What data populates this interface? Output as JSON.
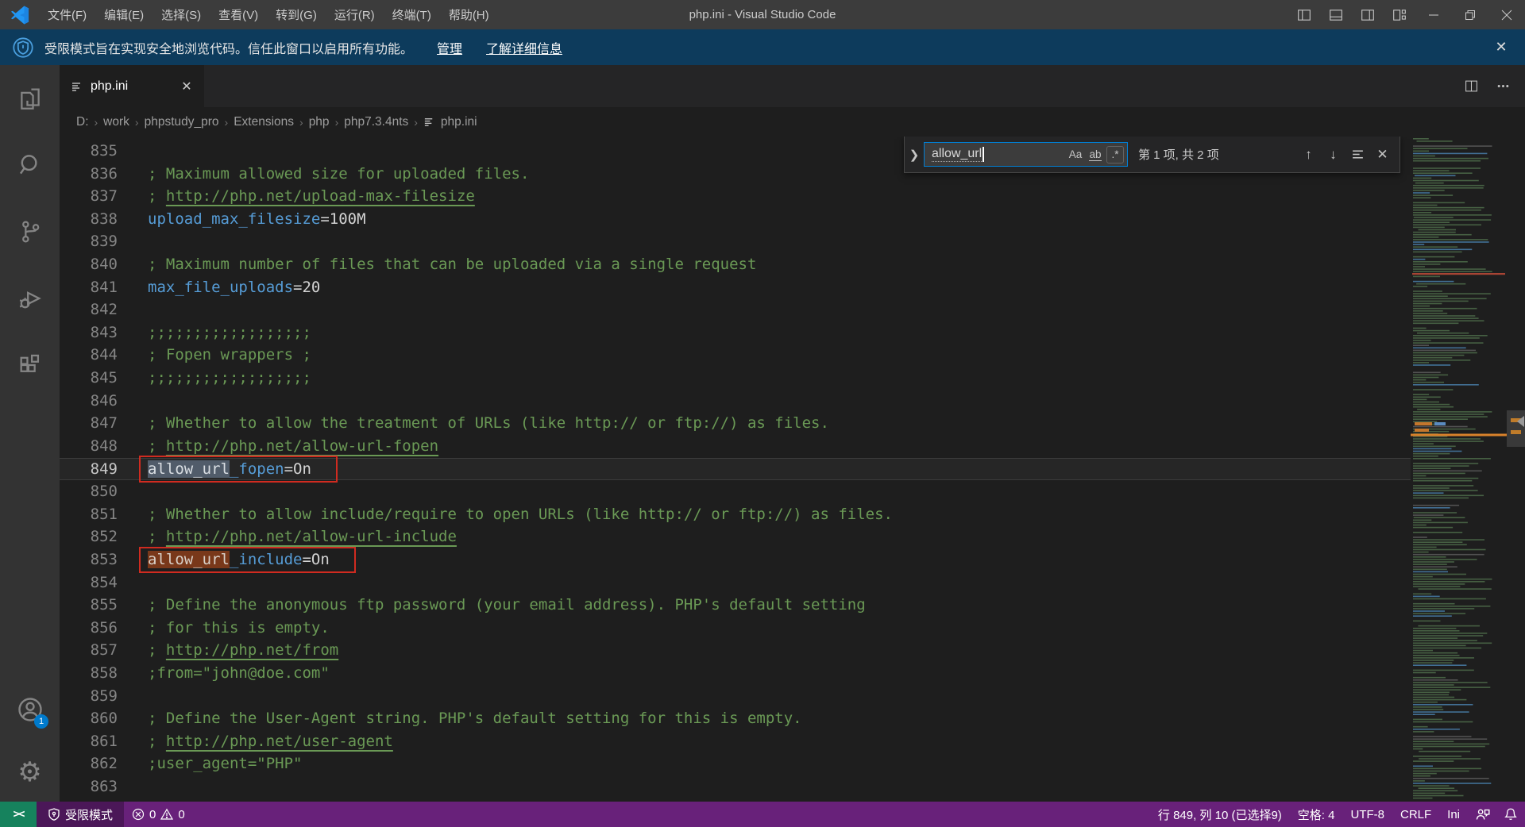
{
  "window": {
    "title": "php.ini - Visual Studio Code"
  },
  "menus": [
    "文件(F)",
    "编辑(E)",
    "选择(S)",
    "查看(V)",
    "转到(G)",
    "运行(R)",
    "终端(T)",
    "帮助(H)"
  ],
  "notification": {
    "message": "受限模式旨在实现安全地浏览代码。信任此窗口以启用所有功能。",
    "manage_label": "管理",
    "learn_more_label": "了解详细信息"
  },
  "activity_bar": {
    "account_badge": "1"
  },
  "tab": {
    "name": "php.ini"
  },
  "breadcrumb": [
    "D:",
    "work",
    "phpstudy_pro",
    "Extensions",
    "php",
    "php7.3.4nts",
    "php.ini"
  ],
  "find": {
    "query": "allow_url",
    "match_case_label": "Aa",
    "whole_word_label": "ab",
    "regex_label": ".*",
    "results": "第 1 项, 共 2 项"
  },
  "editor": {
    "lines": [
      {
        "num": 835,
        "segs": []
      },
      {
        "num": 836,
        "segs": [
          {
            "t": "; Maximum allowed size for uploaded files.",
            "c": "comment"
          }
        ]
      },
      {
        "num": 837,
        "segs": [
          {
            "t": "; ",
            "c": "comment"
          },
          {
            "t": "http://php.net/upload-max-filesize",
            "c": "url"
          }
        ]
      },
      {
        "num": 838,
        "segs": [
          {
            "t": "upload_max_filesize",
            "c": "key"
          },
          {
            "t": "=",
            "c": "op"
          },
          {
            "t": "100M",
            "c": "val"
          }
        ]
      },
      {
        "num": 839,
        "segs": []
      },
      {
        "num": 840,
        "segs": [
          {
            "t": "; Maximum number of files that can be uploaded via a single request",
            "c": "comment"
          }
        ]
      },
      {
        "num": 841,
        "segs": [
          {
            "t": "max_file_uploads",
            "c": "key"
          },
          {
            "t": "=",
            "c": "op"
          },
          {
            "t": "20",
            "c": "val"
          }
        ]
      },
      {
        "num": 842,
        "segs": []
      },
      {
        "num": 843,
        "segs": [
          {
            "t": ";;;;;;;;;;;;;;;;;;",
            "c": "comment"
          }
        ]
      },
      {
        "num": 844,
        "segs": [
          {
            "t": "; Fopen wrappers ;",
            "c": "comment"
          }
        ]
      },
      {
        "num": 845,
        "segs": [
          {
            "t": ";;;;;;;;;;;;;;;;;;",
            "c": "comment"
          }
        ]
      },
      {
        "num": 846,
        "segs": []
      },
      {
        "num": 847,
        "segs": [
          {
            "t": "; Whether to allow the treatment of URLs (like http:// or ftp://) as files.",
            "c": "comment"
          }
        ]
      },
      {
        "num": 848,
        "segs": [
          {
            "t": "; ",
            "c": "comment"
          },
          {
            "t": "http://php.net/allow-url-fopen",
            "c": "url"
          }
        ]
      },
      {
        "num": 849,
        "current": true,
        "segs": [
          {
            "t": "allow_url",
            "c": "key",
            "h": "cur"
          },
          {
            "t": "_fopen",
            "c": "key"
          },
          {
            "t": "=",
            "c": "op"
          },
          {
            "t": "On",
            "c": "val"
          }
        ]
      },
      {
        "num": 850,
        "segs": []
      },
      {
        "num": 851,
        "segs": [
          {
            "t": "; Whether to allow include/require to open URLs (like http:// or ftp://) as files.",
            "c": "comment"
          }
        ]
      },
      {
        "num": 852,
        "segs": [
          {
            "t": "; ",
            "c": "comment"
          },
          {
            "t": "http://php.net/allow-url-include",
            "c": "url"
          }
        ]
      },
      {
        "num": 853,
        "segs": [
          {
            "t": "allow_url",
            "c": "key",
            "h": "find"
          },
          {
            "t": "_include",
            "c": "key"
          },
          {
            "t": "=",
            "c": "op"
          },
          {
            "t": "On",
            "c": "val"
          }
        ]
      },
      {
        "num": 854,
        "segs": []
      },
      {
        "num": 855,
        "segs": [
          {
            "t": "; Define the anonymous ftp password (your email address). PHP's default setting",
            "c": "comment"
          }
        ]
      },
      {
        "num": 856,
        "segs": [
          {
            "t": "; for this is empty.",
            "c": "comment"
          }
        ]
      },
      {
        "num": 857,
        "segs": [
          {
            "t": "; ",
            "c": "comment"
          },
          {
            "t": "http://php.net/from",
            "c": "url"
          }
        ]
      },
      {
        "num": 858,
        "segs": [
          {
            "t": ";from=\"john@doe.com\"",
            "c": "comment"
          }
        ]
      },
      {
        "num": 859,
        "segs": []
      },
      {
        "num": 860,
        "segs": [
          {
            "t": "; Define the User-Agent string. PHP's default setting for this is empty.",
            "c": "comment"
          }
        ]
      },
      {
        "num": 861,
        "segs": [
          {
            "t": "; ",
            "c": "comment"
          },
          {
            "t": "http://php.net/user-agent",
            "c": "url"
          }
        ]
      },
      {
        "num": 862,
        "segs": [
          {
            "t": ";user_agent=\"PHP\"",
            "c": "comment"
          }
        ]
      },
      {
        "num": 863,
        "segs": []
      }
    ],
    "annotations": [
      {
        "line": 849,
        "chars": 18
      },
      {
        "line": 853,
        "chars": 20
      }
    ]
  },
  "status_bar": {
    "restricted_label": "受限模式",
    "error_count": "0",
    "warning_count": "0",
    "right_items": [
      {
        "id": "selection",
        "label": "行 849, 列 10 (已选择9)"
      },
      {
        "id": "indent",
        "label": "空格: 4"
      },
      {
        "id": "encoding",
        "label": "UTF-8"
      },
      {
        "id": "eol",
        "label": "CRLF"
      },
      {
        "id": "language",
        "label": "Ini"
      }
    ]
  },
  "colors": {
    "status_bar": "#68217a",
    "remote_green": "#16825d",
    "banner_blue": "#0d3b5c",
    "find_match_current": "#515c6a",
    "find_match_other": "#79381a",
    "annotation_red": "#d02b20",
    "comment_green": "#6a9955",
    "key_blue": "#569cd6"
  }
}
